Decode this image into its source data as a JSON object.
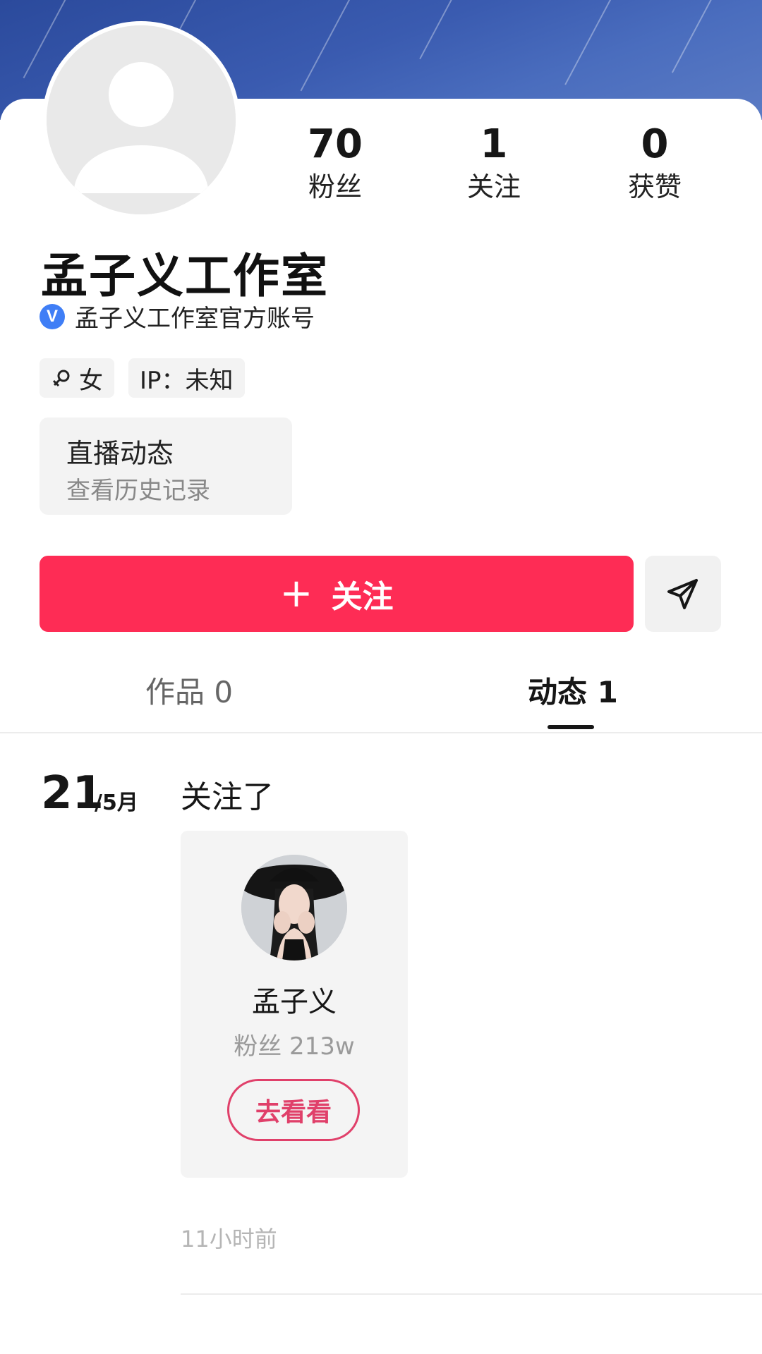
{
  "stats": {
    "fans": {
      "value": "70",
      "label": "粉丝"
    },
    "following": {
      "value": "1",
      "label": "关注"
    },
    "likes": {
      "value": "0",
      "label": "获赞"
    }
  },
  "profile": {
    "name": "孟子义工作室",
    "verification": "孟子义工作室官方账号",
    "gender_tag": "女",
    "ip_tag": "IP：未知"
  },
  "live": {
    "title": "直播动态",
    "subtitle": "查看历史记录"
  },
  "actions": {
    "follow_plus": "+",
    "follow_label": "关注"
  },
  "tabs": [
    {
      "label": "作品 0"
    },
    {
      "label": "动态 1"
    }
  ],
  "moment": {
    "day": "21",
    "month": "/5月",
    "title": "关注了",
    "user": {
      "name": "孟子义",
      "fans": "粉丝 213w",
      "button": "去看看"
    },
    "time": "11小时前"
  },
  "colors": {
    "accent": "#fe2c55",
    "verified_blue": "#3f7ef6",
    "visit_button": "#e0406a"
  },
  "icons": {
    "verified": "v-badge-icon",
    "gender": "female-symbol-icon",
    "share": "paper-plane-icon"
  }
}
